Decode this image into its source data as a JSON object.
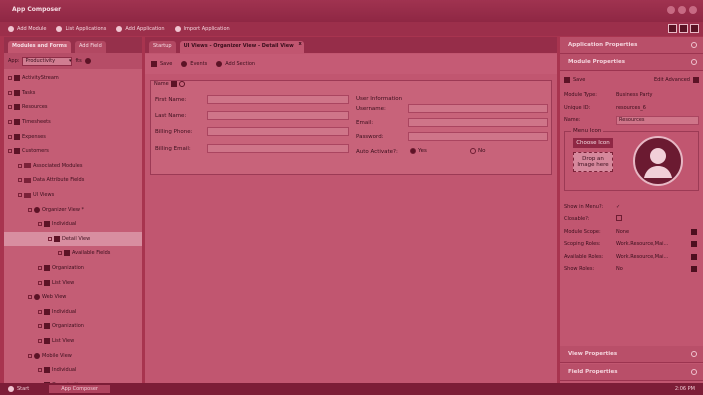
{
  "window": {
    "title": "App Composer"
  },
  "toolbar": {
    "items": [
      "Add Module",
      "List Applications",
      "Add Application",
      "Import Application"
    ]
  },
  "left": {
    "tabs": [
      "Modules and Forms",
      "Add Field"
    ],
    "app_label": "App:",
    "app_value": "Productivity",
    "filter_label": "fts",
    "tree": [
      {
        "label": "ActivityStream",
        "indent": 0
      },
      {
        "label": "Tasks",
        "indent": 0
      },
      {
        "label": "Resources",
        "indent": 0
      },
      {
        "label": "Timesheets",
        "indent": 0
      },
      {
        "label": "Expenses",
        "indent": 0
      },
      {
        "label": "Customers",
        "indent": 0
      },
      {
        "label": "Associated Modules",
        "indent": 1
      },
      {
        "label": "Data Attribute Fields",
        "indent": 1
      },
      {
        "label": "UI Views",
        "indent": 1
      },
      {
        "label": "Organizer View *",
        "indent": 2
      },
      {
        "label": "Individual",
        "indent": 3
      },
      {
        "label": "Detail View",
        "indent": 4
      },
      {
        "label": "Available Fields",
        "indent": 5
      },
      {
        "label": "Organization",
        "indent": 3
      },
      {
        "label": "List View",
        "indent": 3
      },
      {
        "label": "Web View",
        "indent": 2
      },
      {
        "label": "Individual",
        "indent": 3
      },
      {
        "label": "Organization",
        "indent": 3
      },
      {
        "label": "List View",
        "indent": 3
      },
      {
        "label": "Mobile View",
        "indent": 2
      },
      {
        "label": "Individual",
        "indent": 3
      },
      {
        "label": "Organization",
        "indent": 3
      }
    ]
  },
  "center": {
    "tabs": [
      "Startup",
      "UI Views - Organizer View - Detail View"
    ],
    "close_glyph": "x",
    "actions": [
      "Save",
      "Events",
      "Add Section"
    ],
    "section": {
      "title": "Name"
    },
    "left_fields": [
      "First Name:",
      "Last Name:",
      "Billing Phone:",
      "Billing Email:"
    ],
    "user_info_title": "User Information",
    "right_fields": [
      "Username:",
      "Email:",
      "Password:"
    ],
    "auto_activate_label": "Auto Activate?:",
    "yes": "Yes",
    "no": "No"
  },
  "right": {
    "app_props": "Application Properties",
    "module_props": "Module Properties",
    "save": "Save",
    "edit_advanced": "Edit Advanced",
    "module_type_label": "Module Type:",
    "module_type_value": "Business Party",
    "unique_id_label": "Unique ID:",
    "unique_id_value": "resources_6",
    "name_label": "Name:",
    "name_value": "Resources",
    "menu_icon": "Menu Icon",
    "choose_icon": "Choose Icon",
    "drop_image": "Drop an Image here",
    "show_in_menu": "Show in Menu?:",
    "closable": "Closable?:",
    "rows": [
      {
        "k": "Module Scope:",
        "v": "None"
      },
      {
        "k": "Scoping Roles:",
        "v": "Work.Resource,Mai..."
      },
      {
        "k": "Available Roles:",
        "v": "Work.Resource,Mai..."
      },
      {
        "k": "Show Roles:",
        "v": "No"
      }
    ],
    "view_props": "View Properties",
    "field_props": "Field Properties"
  },
  "status": {
    "start": "Start",
    "task": "App Composer",
    "time": "2:06 PM"
  },
  "colors": {
    "tint": "#a8344f",
    "panel": "#c15670"
  }
}
